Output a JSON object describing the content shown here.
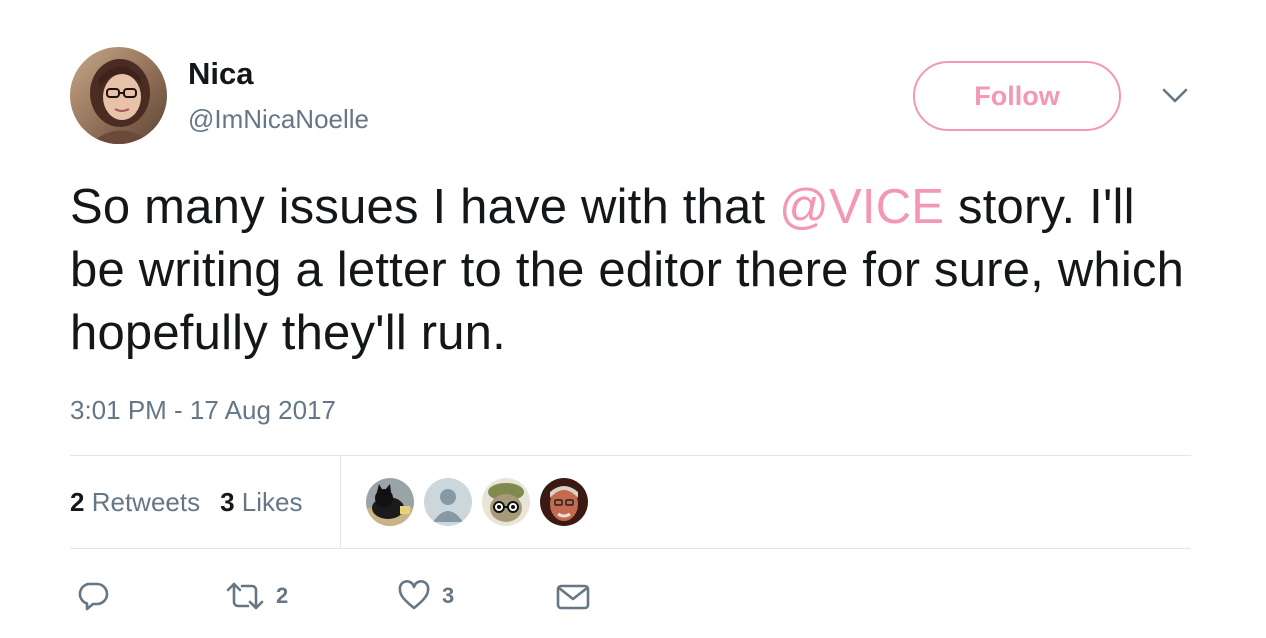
{
  "user": {
    "display_name": "Nica",
    "handle": "@ImNicaNoelle",
    "avatar_icon": "profile-photo"
  },
  "header": {
    "follow_label": "Follow",
    "menu_icon": "chevron-down-icon"
  },
  "tweet": {
    "text_before": "So many issues I have with that ",
    "mention": "@VICE",
    "text_after": " story. I'll be writing a letter to the editor there for sure, which hopefully they'll run.",
    "timestamp": "3:01 PM - 17 Aug 2017"
  },
  "stats": {
    "retweets_count": "2",
    "retweets_label": "Retweets",
    "likes_count": "3",
    "likes_label": "Likes"
  },
  "actions": {
    "reply_icon": "reply-icon",
    "retweet_icon": "retweet-icon",
    "retweet_count": "2",
    "like_icon": "heart-icon",
    "like_count": "3",
    "dm_icon": "envelope-icon"
  },
  "colors": {
    "accent": "#f497b6",
    "text": "#14171a",
    "secondary": "#657786",
    "divider": "#e1e8ed"
  }
}
